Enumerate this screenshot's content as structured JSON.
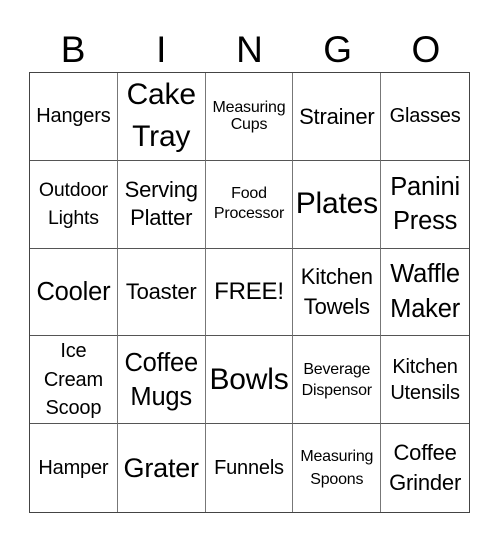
{
  "header": {
    "letters": [
      "B",
      "I",
      "N",
      "G",
      "O"
    ]
  },
  "cells": [
    "Hangers",
    "Cake\nTray",
    "Measuring\nCups",
    "Strainer",
    "Glasses",
    "Outdoor\nLights",
    "Serving\nPlatter",
    "Food\nProcessor",
    "Plates",
    "Panini\nPress",
    "Cooler",
    "Toaster",
    "FREE!",
    "Kitchen\nTowels",
    "Waffle\nMaker",
    "Ice\nCream\nScoop",
    "Coffee\nMugs",
    "Bowls",
    "Beverage\nDispensor",
    "Kitchen\nUtensils",
    "Hamper",
    "Grater",
    "Funnels",
    "Measuring\nSpoons",
    "Coffee\nGrinder"
  ]
}
